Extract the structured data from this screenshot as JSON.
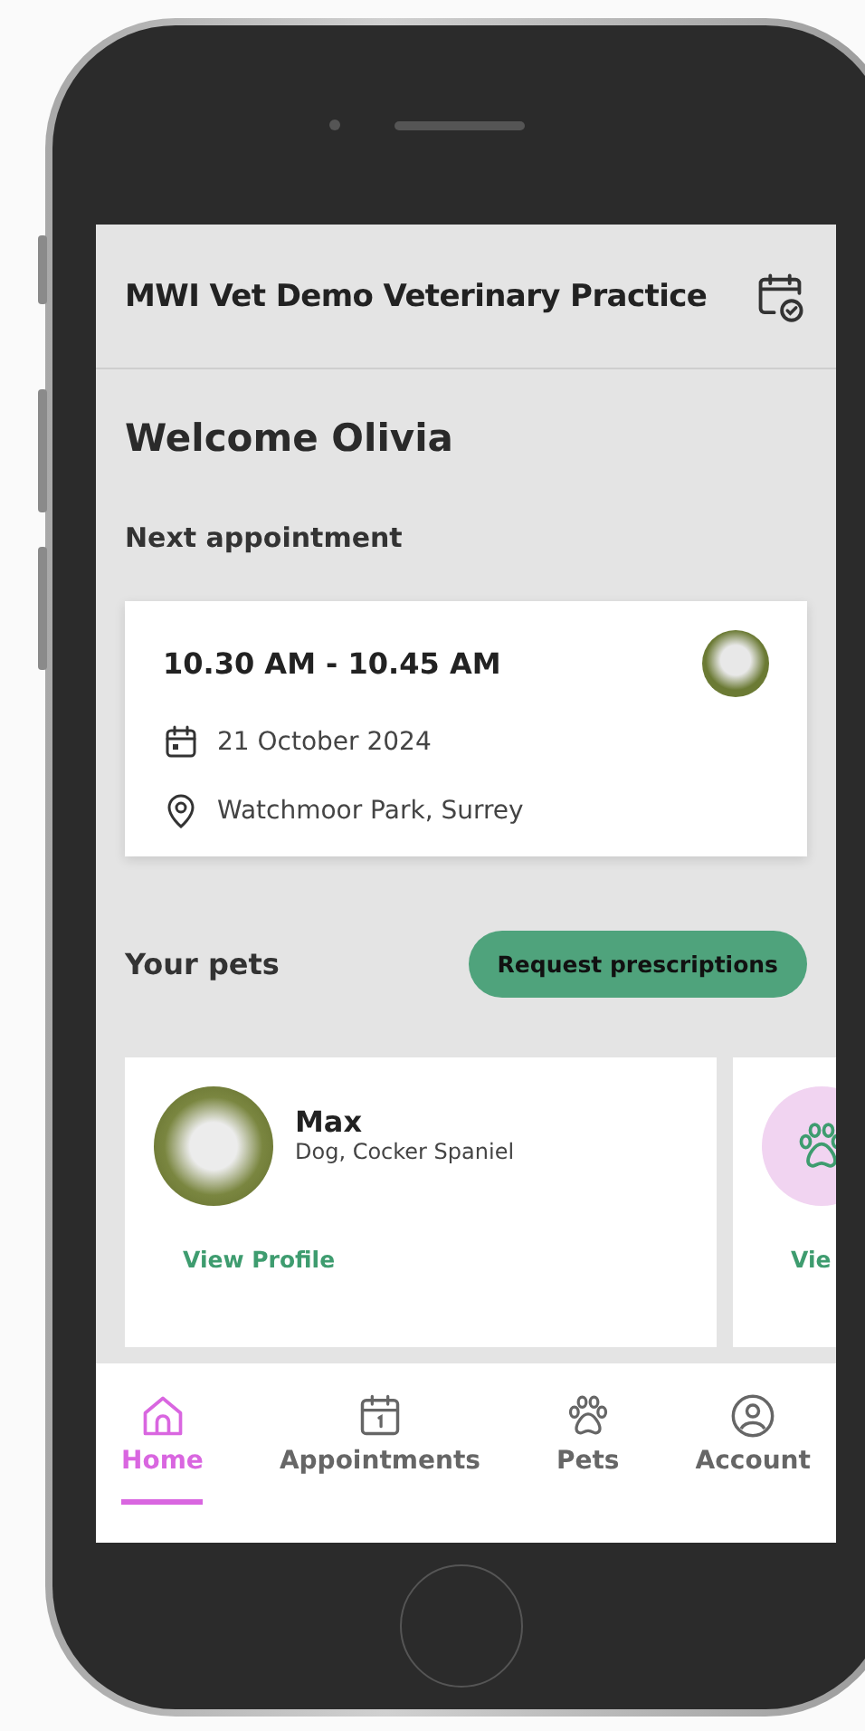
{
  "header": {
    "title": "MWI Vet Demo Veterinary Practice"
  },
  "welcome": "Welcome Olivia",
  "next_appointment": {
    "heading": "Next appointment",
    "time": "10.30 AM - 10.45 AM",
    "date": "21 October 2024",
    "location": "Watchmoor Park, Surrey"
  },
  "pets_section": {
    "heading": "Your pets",
    "button": "Request prescriptions"
  },
  "pets": [
    {
      "kind": "photo",
      "name": "Max",
      "description": "Dog, Cocker Spaniel",
      "link": "View Profile"
    },
    {
      "kind": "placeholder",
      "link": "Vie"
    }
  ],
  "nav": [
    {
      "kind": "home",
      "label": "Home",
      "selected": true
    },
    {
      "kind": "appointments",
      "label": "Appointments",
      "selected": false
    },
    {
      "kind": "pets",
      "label": "Pets",
      "selected": false
    },
    {
      "kind": "account",
      "label": "Account",
      "selected": false
    }
  ]
}
